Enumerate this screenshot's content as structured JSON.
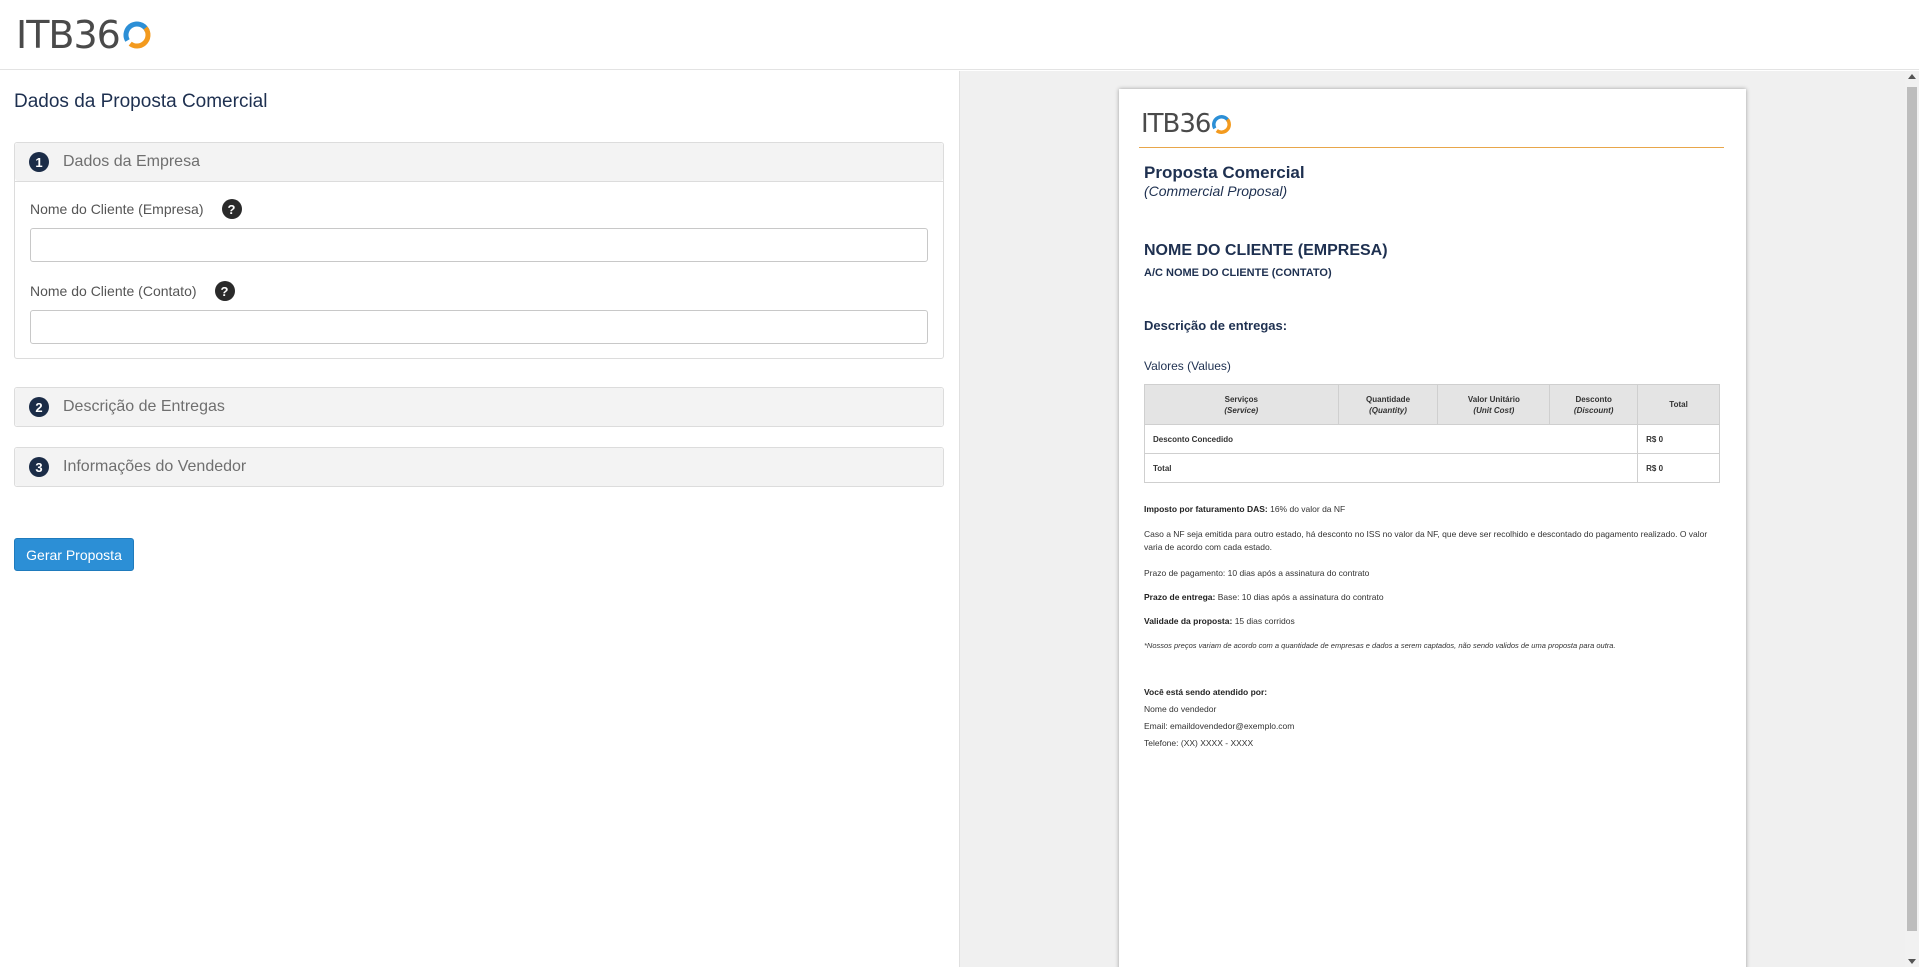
{
  "header": {
    "logo_text": "ITB36"
  },
  "form": {
    "title": "Dados da Proposta Comercial",
    "sections": [
      {
        "num": "1",
        "label": "Dados da Empresa"
      },
      {
        "num": "2",
        "label": "Descrição de Entregas"
      },
      {
        "num": "3",
        "label": "Informações do Vendedor"
      }
    ],
    "fields": {
      "client_company_label": "Nome do Cliente (Empresa)",
      "client_company_value": "",
      "client_contact_label": "Nome do Cliente (Contato)",
      "client_contact_value": "",
      "help_glyph": "?"
    },
    "submit_label": "Gerar Proposta"
  },
  "preview": {
    "logo_text": "ITB36",
    "title": "Proposta Comercial",
    "subtitle": "(Commercial Proposal)",
    "client": "NOME DO CLIENTE (EMPRESA)",
    "contact": "A/C NOME DO CLIENTE (CONTATO)",
    "deliverables_heading": "Descrição de entregas:",
    "values_heading": "Valores (Values)",
    "table": {
      "headers": [
        {
          "pt": "Serviços",
          "en": "(Service)"
        },
        {
          "pt": "Quantidade",
          "en": "(Quantity)"
        },
        {
          "pt": "Valor Unitário",
          "en": "(Unit Cost)"
        },
        {
          "pt": "Desconto",
          "en": "(Discount)"
        },
        {
          "pt": "Total",
          "en": ""
        }
      ],
      "rows": [
        {
          "label": "Desconto Concedido",
          "value": "R$ 0"
        },
        {
          "label": "Total",
          "value": "R$ 0"
        }
      ]
    },
    "tax_label": "Imposto por faturamento DAS:",
    "tax_value": " 16% do valor da NF",
    "iss_note": "Caso a NF seja emitida para outro estado, há desconto no ISS no valor da NF, que deve ser recolhido e descontado do pagamento realizado. O valor varia de acordo com cada estado.",
    "payment_term": "Prazo de pagamento: 10 dias após a assinatura do contrato",
    "delivery_label": "Prazo de entrega:",
    "delivery_value": " Base: 10 dias após a assinatura do contrato",
    "validity_label": "Validade da proposta:",
    "validity_value": " 15 dias corridos",
    "disclaimer": "*Nossos preços variam de acordo com a quantidade de empresas e dados a serem captados, não sendo validos de uma proposta para outra.",
    "attended_by": "Você está sendo atendido por:",
    "seller_name": "Nome do vendedor",
    "seller_email": "Email: emaildovendedor@exemplo.com",
    "seller_phone": "Telefone: (XX) XXXX - XXXX"
  },
  "colors": {
    "brand_navy": "#1e3050",
    "accent_orange": "#f39a1e",
    "accent_blue": "#2c8fd6",
    "button": "#2c8fd6"
  }
}
